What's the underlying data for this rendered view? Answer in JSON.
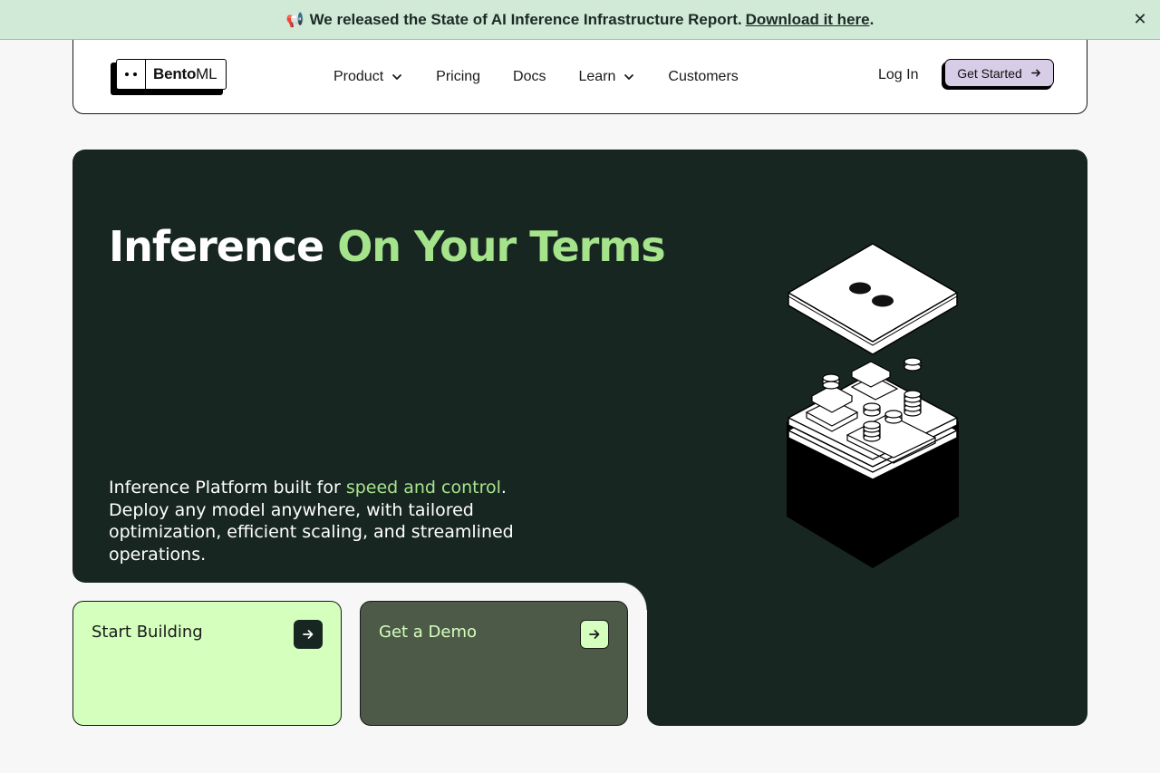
{
  "banner": {
    "icon": "megaphone-icon",
    "text": "We released the State of AI Inference Infrastructure Report.",
    "link": "Download it here",
    "suffix": ".",
    "close_icon": "close-icon",
    "bg_color": "#d1e9d7"
  },
  "nav": {
    "logo": {
      "strong": "Bento",
      "light": "ML"
    },
    "links": [
      {
        "label": "Product",
        "has_dropdown": true
      },
      {
        "label": "Pricing",
        "has_dropdown": false
      },
      {
        "label": "Docs",
        "has_dropdown": false
      },
      {
        "label": "Learn",
        "has_dropdown": true
      },
      {
        "label": "Customers",
        "has_dropdown": false
      }
    ],
    "login": "Log In",
    "cta": "Get Started",
    "cta_color": "#d7cde6"
  },
  "hero": {
    "title_plain": "Inference ",
    "title_accent": "On Your Terms",
    "desc_pre": "Inference Platform built for ",
    "desc_accent": "speed and control",
    "desc_post": ". Deploy any model anywhere, with tailored optimization, efficient scaling, and streamlined operations.",
    "bg_color": "#182622",
    "accent_color": "#a6e48c"
  },
  "cards": {
    "start": {
      "label": "Start Building",
      "color": "#d5ffbd"
    },
    "demo": {
      "label": "Get a Demo",
      "color": "#4d5a48"
    }
  }
}
